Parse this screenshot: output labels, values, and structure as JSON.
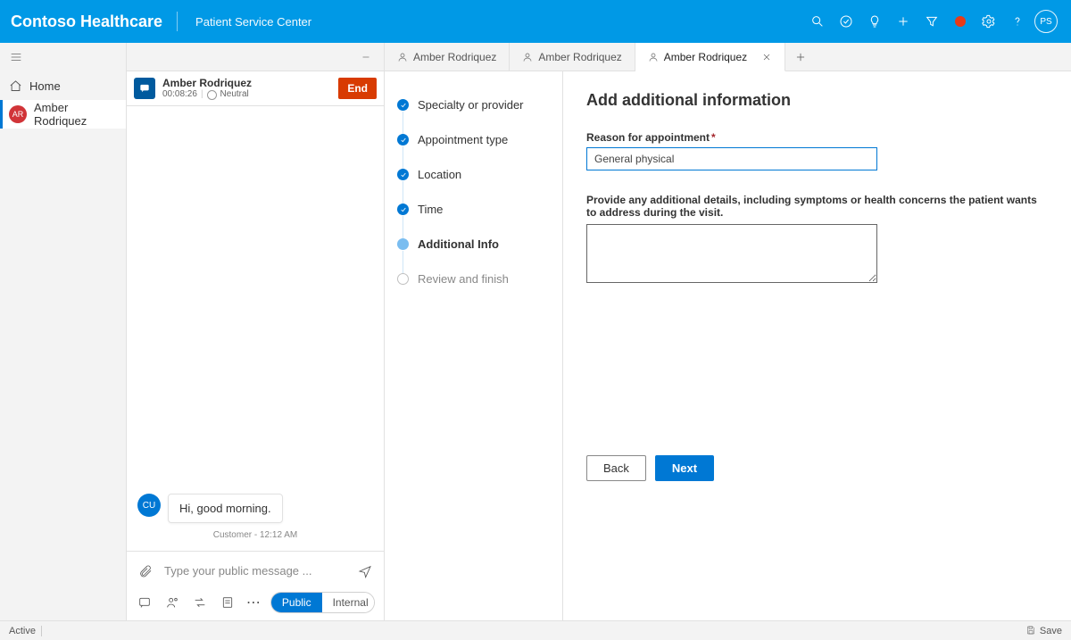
{
  "topbar": {
    "brand": "Contoso Healthcare",
    "subtitle": "Patient Service Center",
    "avatar_initials": "PS"
  },
  "leftnav": {
    "home_label": "Home",
    "selected_label": "Amber Rodriquez",
    "selected_initials": "AR"
  },
  "conversation": {
    "session_name": "Amber Rodriquez",
    "duration": "00:08:26",
    "sentiment": "Neutral",
    "end_label": "End",
    "message_sender_initials": "CU",
    "message_text": "Hi, good morning.",
    "message_meta": "Customer - 12:12 AM",
    "compose_placeholder": "Type your public message ...",
    "seg_public": "Public",
    "seg_internal": "Internal"
  },
  "tabs": {
    "tab1": "Amber Rodriquez",
    "tab2": "Amber Rodriquez",
    "tab3": "Amber Rodriquez"
  },
  "stepper": {
    "s1": "Specialty or provider",
    "s2": "Appointment type",
    "s3": "Location",
    "s4": "Time",
    "s5": "Additional Info",
    "s6": "Review and finish"
  },
  "form": {
    "title": "Add additional information",
    "reason_label": "Reason for appointment",
    "reason_value": "General physical",
    "details_label": "Provide any additional details, including symptoms or health concerns the patient wants to address during the visit.",
    "back": "Back",
    "next": "Next"
  },
  "footer": {
    "status": "Active",
    "save": "Save"
  }
}
